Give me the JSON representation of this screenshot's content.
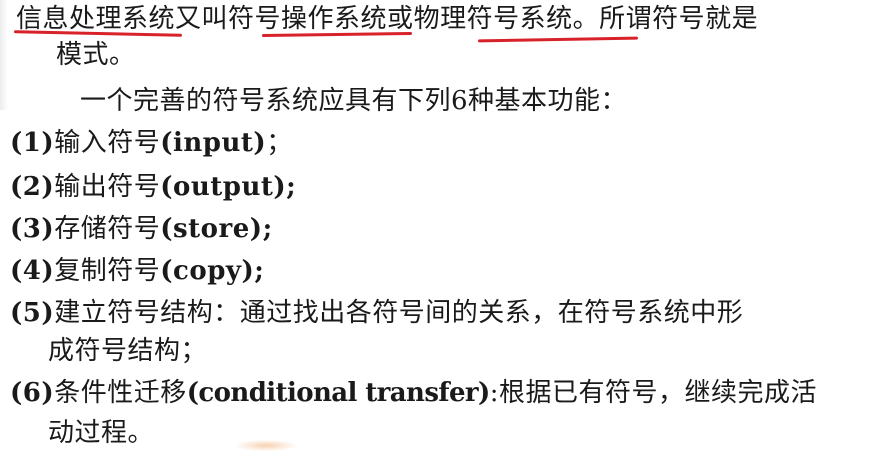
{
  "intro": {
    "part1": "信息处理系统",
    "part2": "又叫",
    "part3": "符号操作系统",
    "part4": "或",
    "part5": "物理符号系统",
    "part6": "。所谓符号就是",
    "line2": "模式。",
    "line3": "一个完善的符号系统应具有下列6种基本功能："
  },
  "functions": [
    {
      "num": "(1)",
      "text": "输入符号",
      "latin": "(input)",
      "end": "；"
    },
    {
      "num": "(2)",
      "text": "输出符号",
      "latin": "(output)",
      "end": ";"
    },
    {
      "num": "(3)",
      "text": "存储符号",
      "latin": "(store)",
      "end": ";"
    },
    {
      "num": "(4)",
      "text": "复制符号",
      "latin": "(copy)",
      "end": ";"
    },
    {
      "num": "(5)",
      "text": "建立符号结构：通过找出各符号间的关系，在符号系统中形",
      "cont": "成符号结构；"
    },
    {
      "num": "(6)",
      "text": "条件性迁移",
      "latin": "(conditional transfer)",
      "end": ":根据已有符号，继续完成活",
      "cont": "动过程。"
    }
  ],
  "colors": {
    "text": "#1a1a1a",
    "underline": "#d8222a",
    "background": "#ffffff"
  }
}
